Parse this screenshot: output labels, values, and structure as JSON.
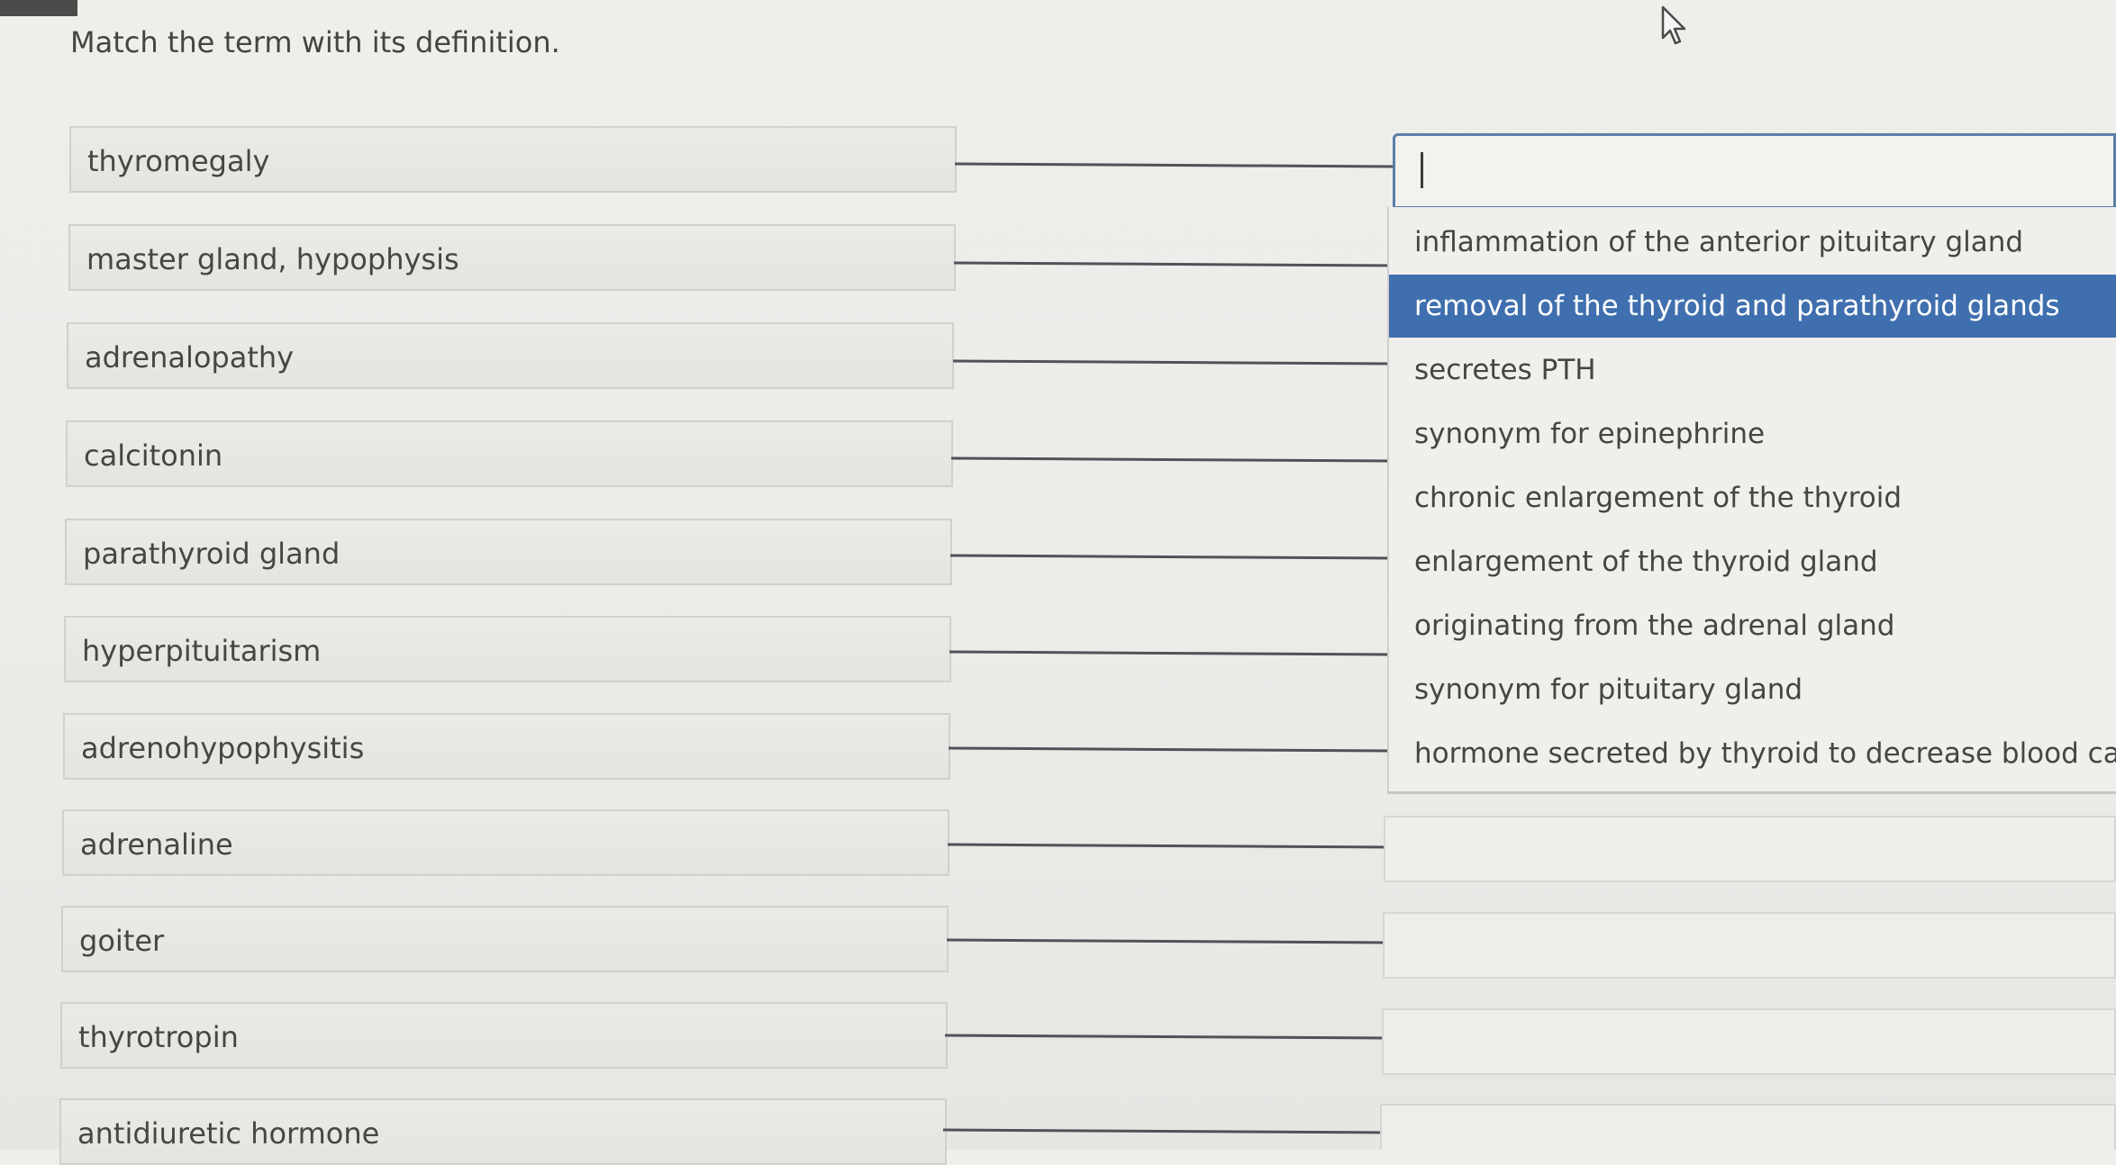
{
  "question": {
    "prompt": "Match the term with its definition."
  },
  "terms": [
    {
      "label": "thyromegaly"
    },
    {
      "label": "master gland, hypophysis"
    },
    {
      "label": "adrenalopathy"
    },
    {
      "label": "calcitonin"
    },
    {
      "label": "parathyroid gland"
    },
    {
      "label": "hyperpituitarism"
    },
    {
      "label": "adrenohypophysitis"
    },
    {
      "label": "adrenaline"
    },
    {
      "label": "goiter"
    },
    {
      "label": "thyrotropin"
    },
    {
      "label": "antidiuretic hormone"
    }
  ],
  "dropdown": {
    "highlighted_option": "removal of the thyroid and parathyroid glands",
    "options": [
      {
        "label": "inflammation of the anterior pituitary gland"
      },
      {
        "label": "removal of the thyroid and parathyroid glands"
      },
      {
        "label": "secretes PTH"
      },
      {
        "label": "synonym for epinephrine"
      },
      {
        "label": "chronic enlargement of the thyroid"
      },
      {
        "label": "enlargement of the thyroid gland"
      },
      {
        "label": "originating from the adrenal gland"
      },
      {
        "label": "synonym for pituitary gland"
      },
      {
        "label": "hormone secreted by thyroid to decrease blood calcium"
      }
    ]
  },
  "icons": {
    "cursor": "mouse-pointer-icon"
  },
  "colors": {
    "highlight": "#3f6fae",
    "focus_border": "#5a7fa8",
    "connector": "#4f5258"
  }
}
